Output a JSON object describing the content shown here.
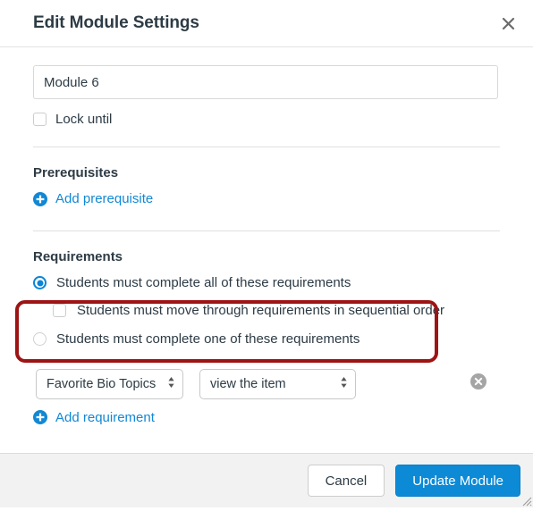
{
  "dialog": {
    "title": "Edit Module Settings",
    "close_icon": "close-icon"
  },
  "form": {
    "module_name": {
      "value": "Module 6",
      "placeholder": "Module Name"
    },
    "lock_until": {
      "label": "Lock until",
      "checked": false
    }
  },
  "prerequisites": {
    "heading": "Prerequisites",
    "add_link": "Add prerequisite",
    "add_icon": "plus-circle-icon"
  },
  "requirements": {
    "heading": "Requirements",
    "option_all": "Students must complete all of these requirements",
    "sequential": "Students must move through requirements in sequential order",
    "option_one": "Students must complete one of these requirements",
    "selected_option": "all",
    "sequential_checked": false,
    "add_link": "Add requirement",
    "add_icon": "plus-circle-icon",
    "rows": [
      {
        "item_select": {
          "value": "Favorite Bio Topics",
          "options": [
            "Favorite Bio Topics"
          ]
        },
        "type_select": {
          "value": "view the item",
          "options": [
            "view the item"
          ]
        },
        "delete_icon": "delete-circle-icon"
      }
    ]
  },
  "footer": {
    "cancel_label": "Cancel",
    "submit_label": "Update Module"
  },
  "colors": {
    "accent_blue": "#0c8ad6",
    "link_blue": "#1288d4",
    "annotation_red": "#9d1414",
    "text": "#2d3b45",
    "footer_bg": "#f2f2f2"
  }
}
